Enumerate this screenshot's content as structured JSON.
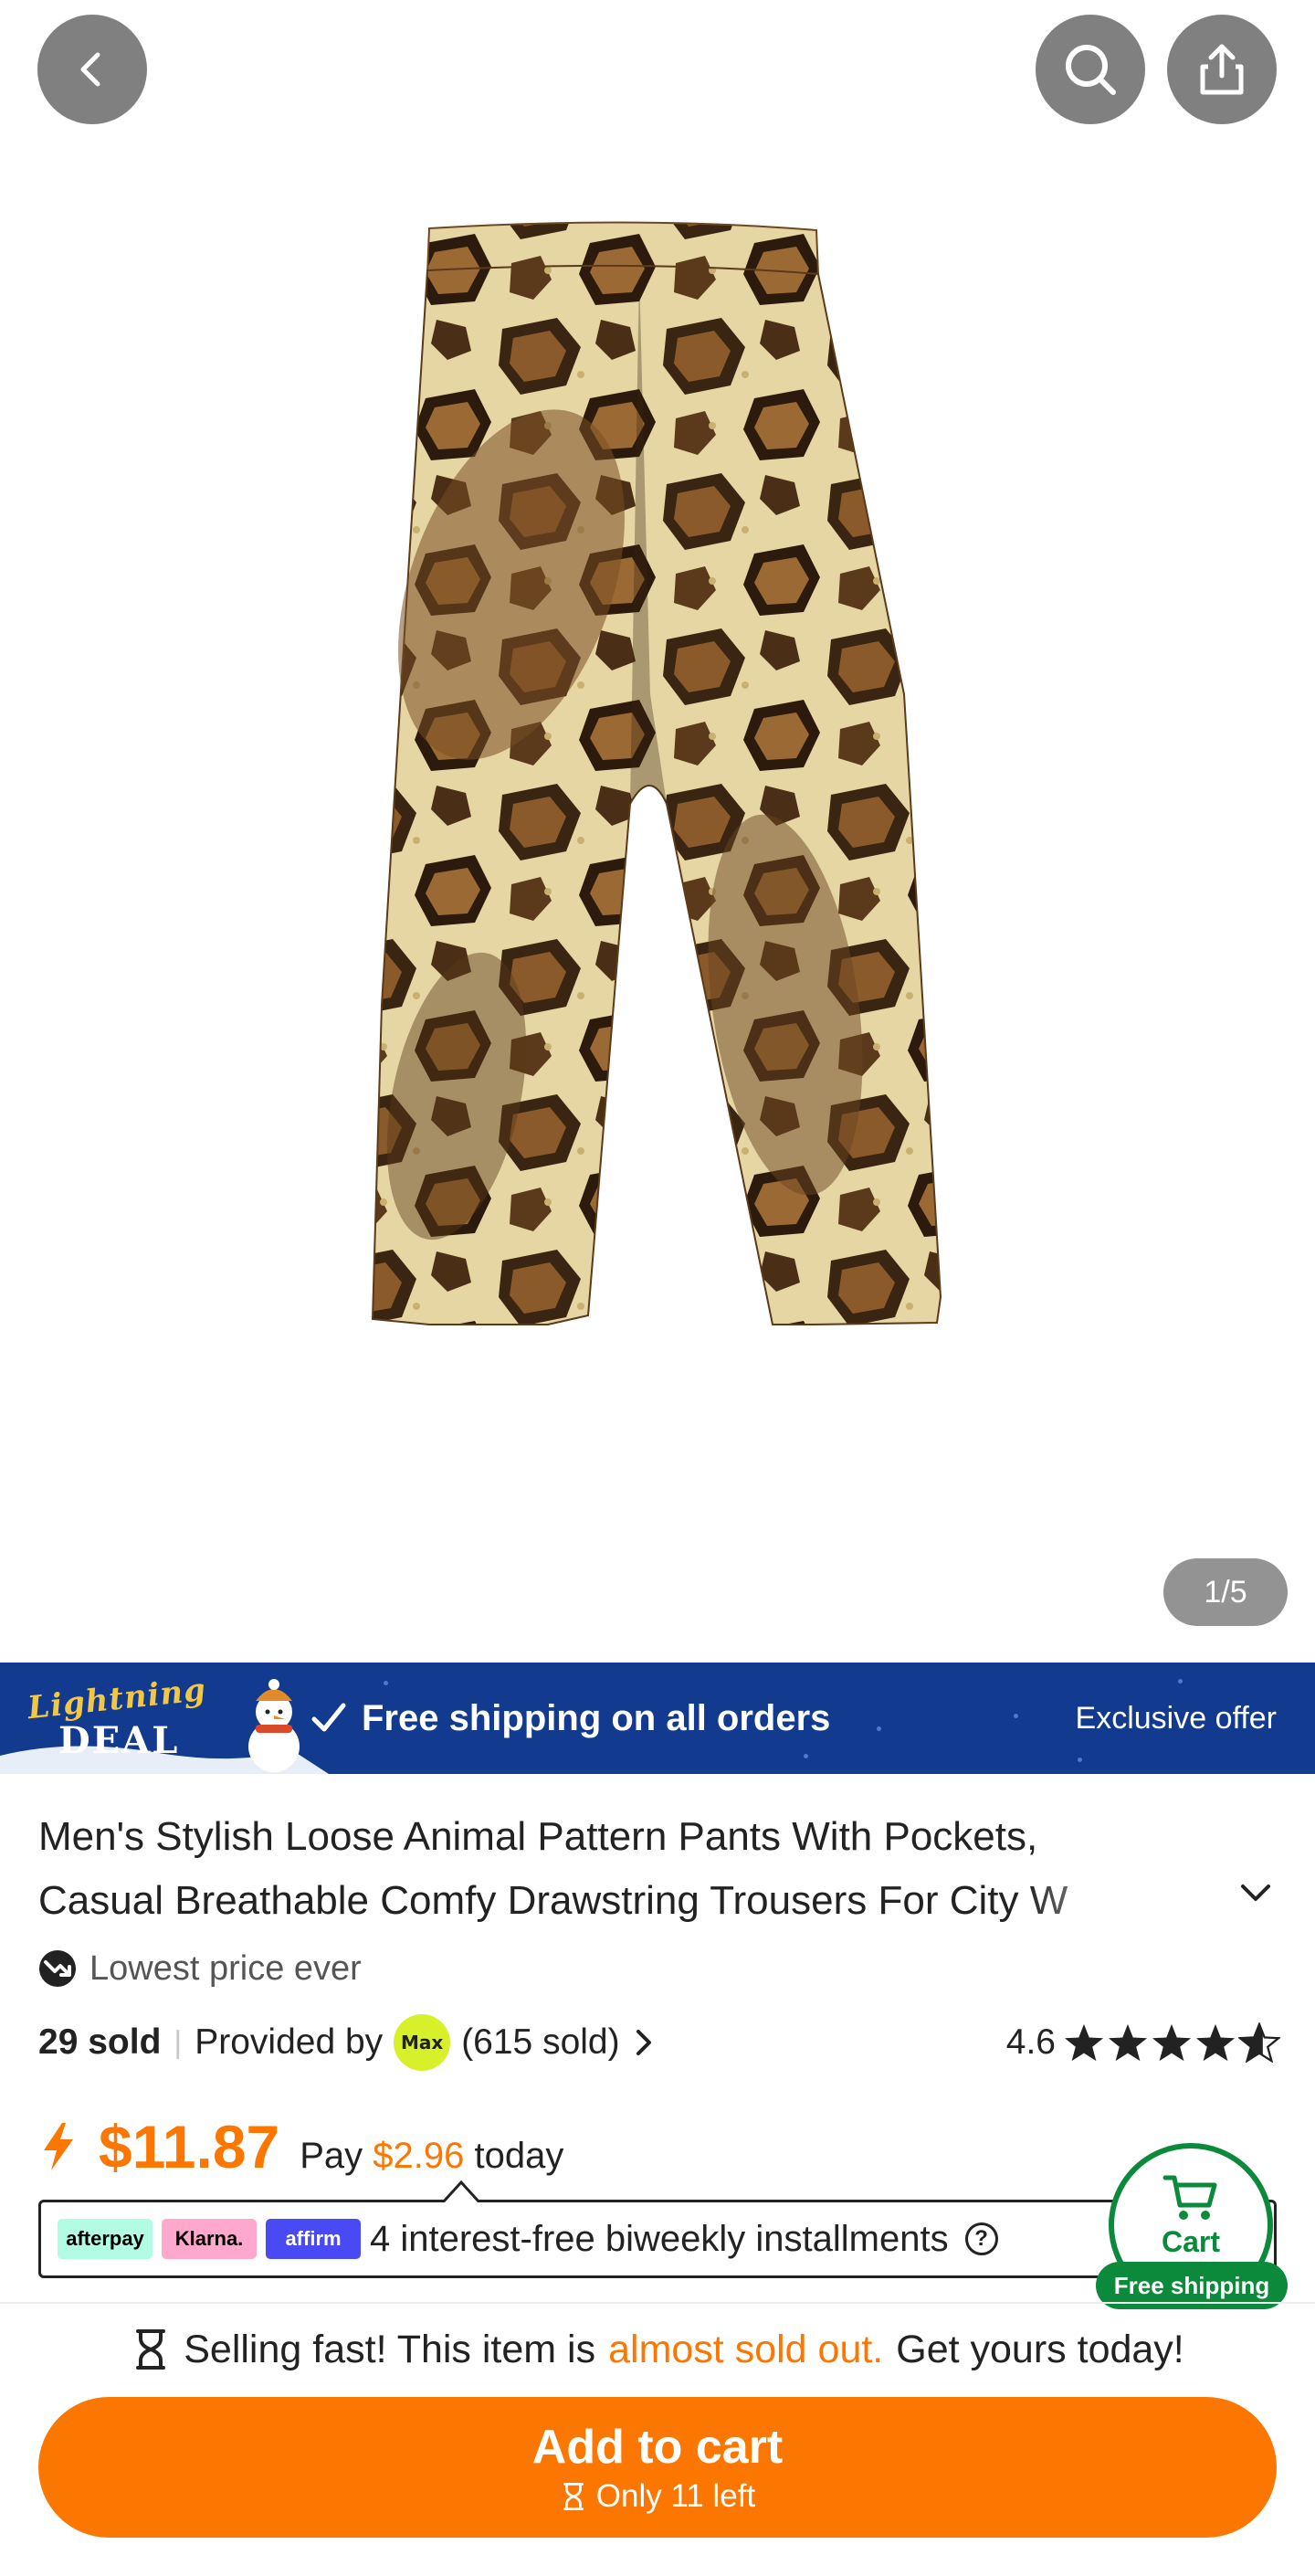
{
  "header": {
    "back_icon": "chevron-left-icon",
    "search_icon": "search-icon",
    "share_icon": "share-icon"
  },
  "gallery": {
    "indicator": "1/5",
    "current": 1,
    "total": 5
  },
  "banner": {
    "deal_line1": "Lightning",
    "deal_line2": "DEAL",
    "free_shipping": "Free shipping on all orders",
    "exclusive": "Exclusive offer",
    "background": "#123a8e"
  },
  "product": {
    "title_line1": "Men's Stylish Loose Animal Pattern Pants With Pockets,",
    "title_line2": "Casual Breathable Comfy Drawstring Trousers For City W",
    "lowest_price": "Lowest price ever",
    "sold": "29 sold",
    "provided_by": "Provided by",
    "store_logo_text": "Max",
    "store_sold": "(615 sold)",
    "rating": "4.6",
    "rating_value": 4.6,
    "rating_max": 5
  },
  "price": {
    "amount": "$11.87",
    "pay_prefix": "Pay",
    "pay_amount": "$2.96",
    "pay_suffix": "today",
    "accent": "#fb7701"
  },
  "installments": {
    "afterpay": "afterpay",
    "klarna": "Klarna.",
    "affirm": "affirm",
    "text": "4 interest-free biweekly installments",
    "help": "?"
  },
  "cart": {
    "label": "Cart",
    "free_shipping": "Free shipping",
    "color": "#0a8a3a"
  },
  "footer": {
    "selling_prefix": "Selling fast! This item is",
    "selling_highlight": "almost sold out.",
    "selling_suffix": "Get yours today!",
    "add_to_cart": "Add to cart",
    "stock": "Only 11 left"
  }
}
